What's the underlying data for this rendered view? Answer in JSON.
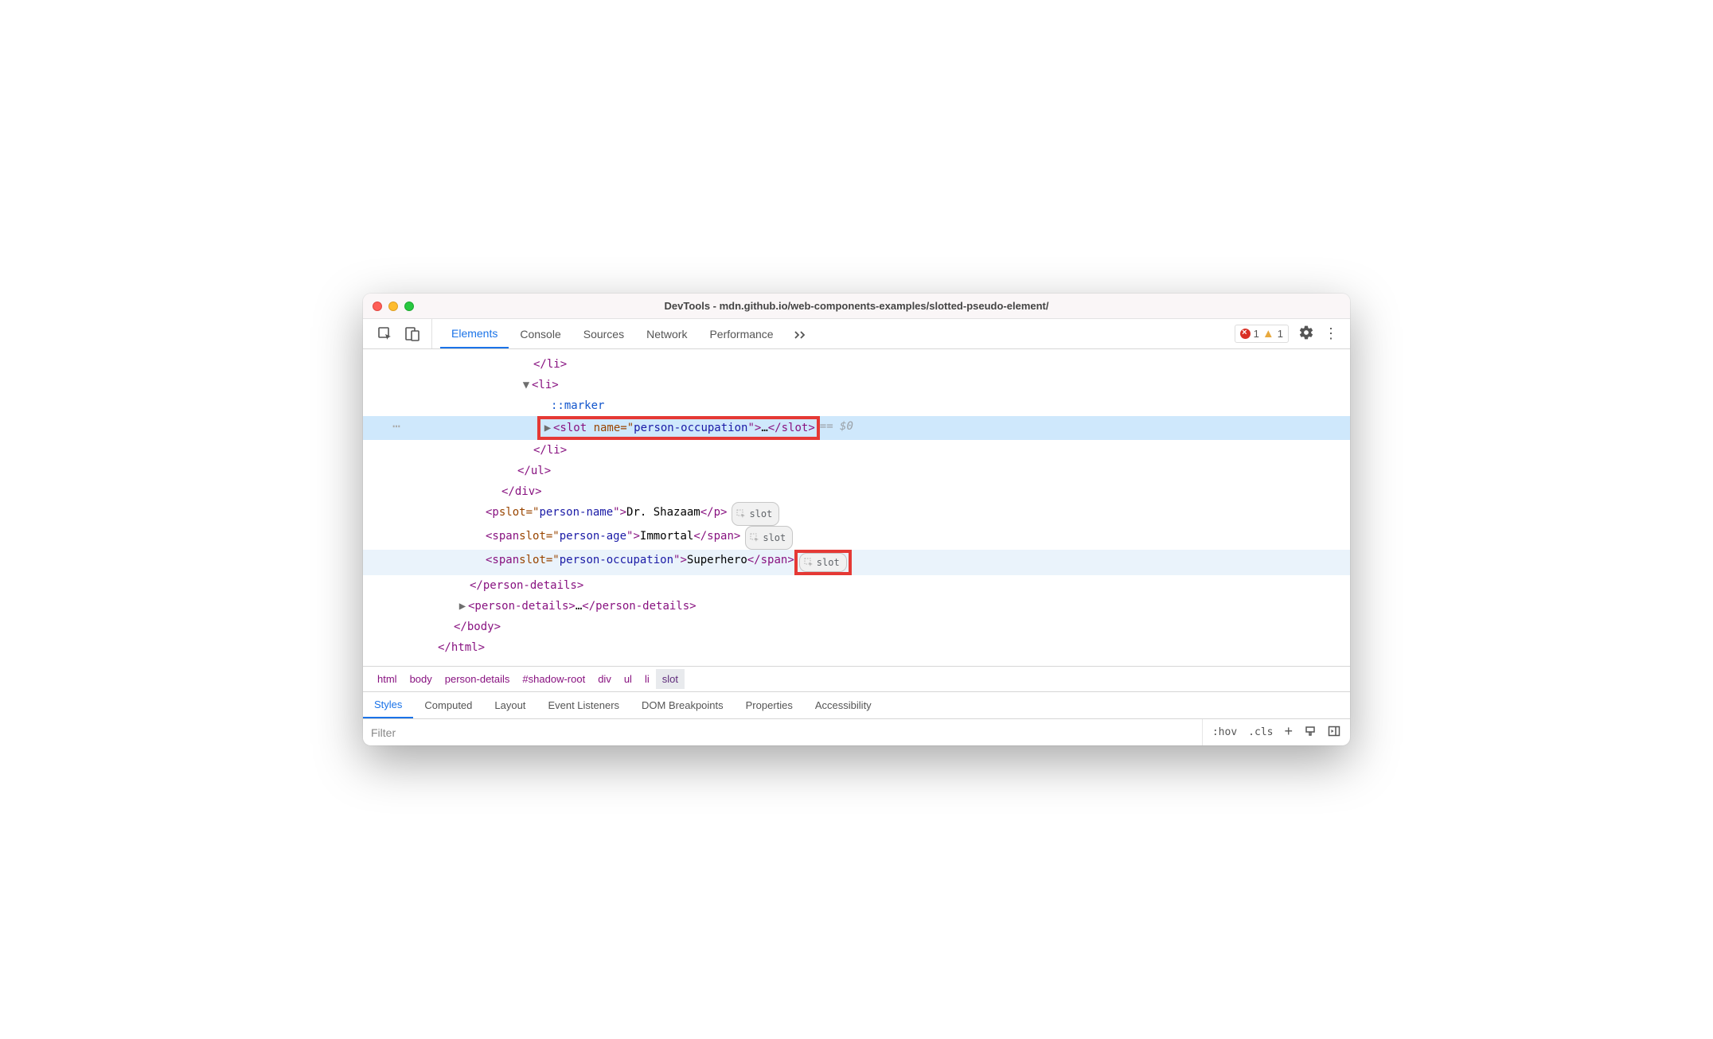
{
  "title": "DevTools - mdn.github.io/web-components-examples/slotted-pseudo-element/",
  "toolbar": {
    "tabs": [
      "Elements",
      "Console",
      "Sources",
      "Network",
      "Performance"
    ],
    "active_tab": "Elements",
    "errors": "1",
    "warnings": "1"
  },
  "dom": {
    "li_close_1": "</li>",
    "li_open": "<li>",
    "marker": "::marker",
    "slot_open_pre": "<slot ",
    "slot_attr_name": "name",
    "slot_attr_eq": "=\"",
    "slot_attr_val": "person-occupation",
    "slot_attr_post": "\">",
    "slot_ellipsis": "…",
    "slot_close": "</slot>",
    "selected_ref": " == $0",
    "li_close_2": "</li>",
    "ul_close": "</ul>",
    "div_close": "</div>",
    "p_line": {
      "open_pre": "<p ",
      "attr_name": "slot",
      "eq": "=\"",
      "attr_val": "person-name",
      "post": "\">",
      "text": "Dr. Shazaam",
      "close": "</p>"
    },
    "span_age": {
      "open_pre": "<span ",
      "attr_name": "slot",
      "eq": "=\"",
      "attr_val": "person-age",
      "post": "\">",
      "text": "Immortal",
      "close": "</span>"
    },
    "span_occ": {
      "open_pre": "<span ",
      "attr_name": "slot",
      "eq": "=\"",
      "attr_val": "person-occupation",
      "post": "\">",
      "text": "Superhero",
      "close": "</span>"
    },
    "pill_label": "slot",
    "person_close": "</person-details>",
    "person2_open": "<person-details>",
    "person2_ellipsis": "…",
    "person2_close": "</person-details>",
    "body_close": "</body>",
    "html_close": "</html>"
  },
  "breadcrumbs": [
    "html",
    "body",
    "person-details",
    "#shadow-root",
    "div",
    "ul",
    "li",
    "slot"
  ],
  "breadcrumb_selected": "slot",
  "subtabs": [
    "Styles",
    "Computed",
    "Layout",
    "Event Listeners",
    "DOM Breakpoints",
    "Properties",
    "Accessibility"
  ],
  "subtab_active": "Styles",
  "filter": {
    "placeholder": "Filter",
    "hov": ":hov",
    "cls": ".cls"
  }
}
